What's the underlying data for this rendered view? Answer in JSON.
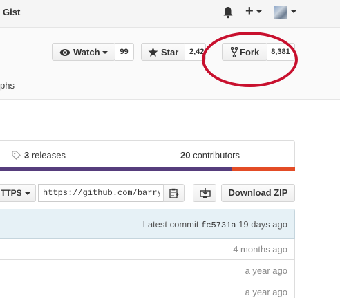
{
  "header": {
    "title": "Gist",
    "plus_label": "+"
  },
  "repo_actions": {
    "watch": {
      "label": "Watch",
      "count": "99"
    },
    "star": {
      "label": "Star",
      "count": "2,42"
    },
    "fork": {
      "label": "Fork",
      "count": "8,381"
    }
  },
  "nav": {
    "graphs_label": "phs"
  },
  "stats": {
    "releases_count": "3",
    "releases_label": " releases",
    "contributors_count": "20",
    "contributors_label": " contributors"
  },
  "languages": [
    {
      "color": "#563d7c",
      "fraction": 0.79
    },
    {
      "color": "#e34c26",
      "fraction": 0.21
    }
  ],
  "clone": {
    "protocol_label": "TTPS",
    "url_value": "https://github.com/barryclark/jekyll-now.git",
    "download_label": "Download ZIP"
  },
  "latest_commit": {
    "prefix": "Latest commit ",
    "sha": "fc5731a",
    "age": " 19 days ago"
  },
  "files": [
    {
      "age": "4 months ago"
    },
    {
      "age": "a year ago"
    },
    {
      "age": "a year ago"
    }
  ],
  "annotation": {
    "color": "#c8102e"
  }
}
